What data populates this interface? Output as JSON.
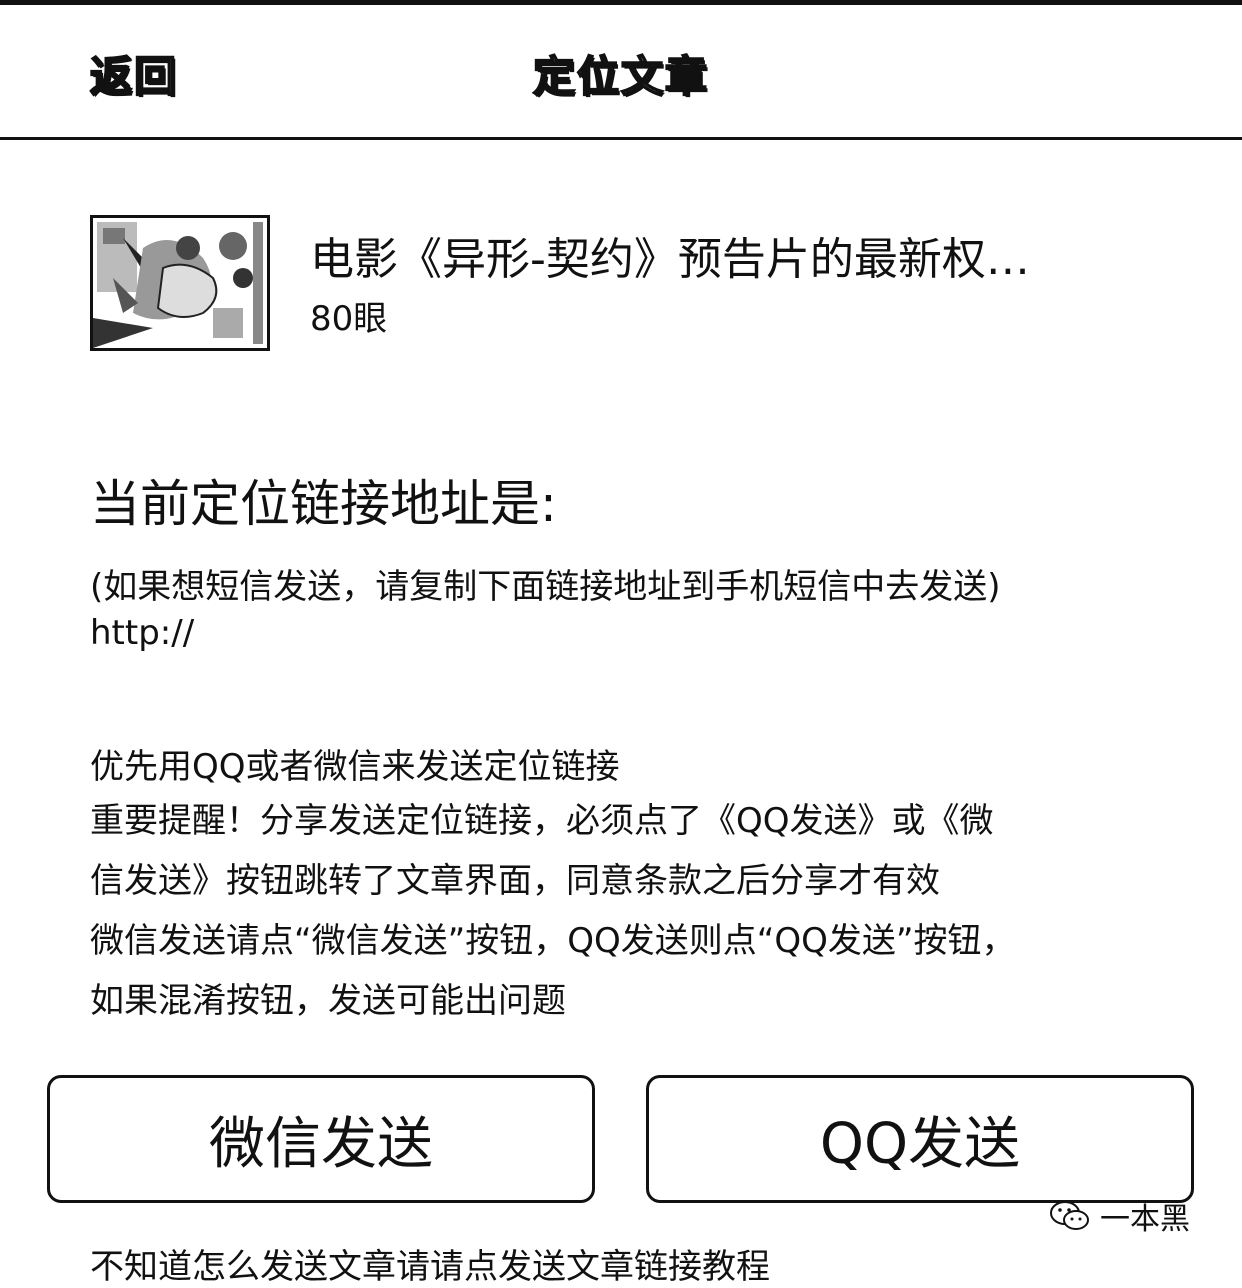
{
  "header": {
    "back_label": "返回",
    "title": "定位文章"
  },
  "article": {
    "thumbnail_icon": "movie-poster-thumbnail",
    "title": "电影《异形-契约》预告片的最新权…",
    "views": "80眼"
  },
  "link_section": {
    "heading": "当前定位链接地址是:",
    "hint": "(如果想短信发送，请复制下面链接地址到手机短信中去发送)",
    "url": "http://"
  },
  "notes": {
    "line1": "优先用QQ或者微信来发送定位链接",
    "line2": "重要提醒！分享发送定位链接，必须点了《QQ发送》或《微",
    "line3": "信发送》按钮跳转了文章界面，同意条款之后分享才有效",
    "line4": "微信发送请点“微信发送”按钮，QQ发送则点“QQ发送”按钮，",
    "line5": "如果混淆按钮，发送可能出问题"
  },
  "buttons": {
    "wechat_label": "微信发送",
    "qq_label": "QQ发送"
  },
  "watermark": {
    "icon": "wechat-icon",
    "text": "一本黑"
  },
  "footer": {
    "tutorial_text": "不知道怎么发送文章请请点发送文章链接教程"
  }
}
